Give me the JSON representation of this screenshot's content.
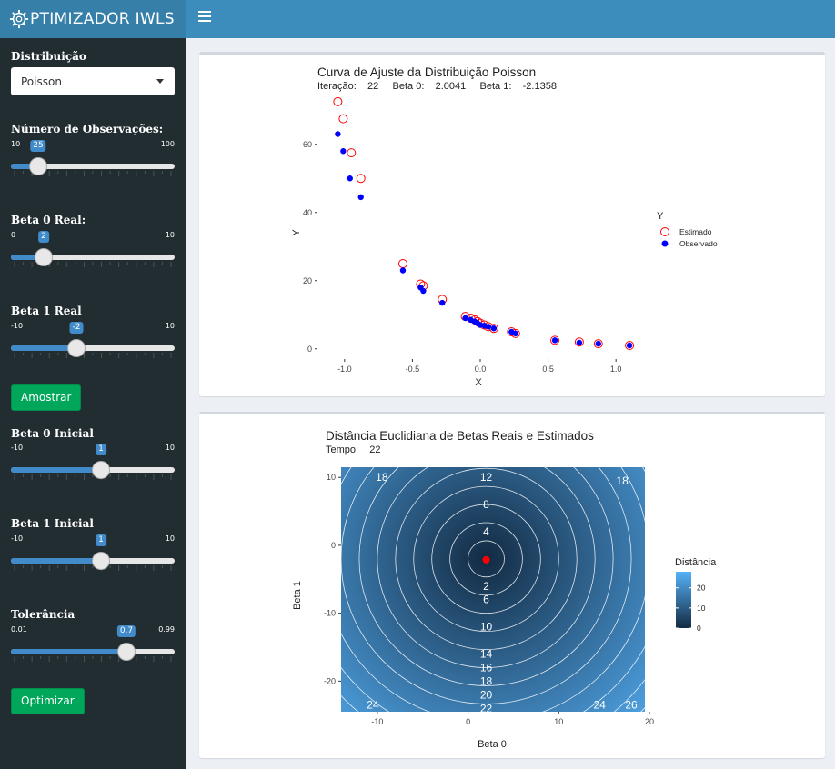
{
  "header": {
    "app_title": "PTIMIZADOR IWLS"
  },
  "sidebar": {
    "distribution": {
      "label": "Distribuição",
      "selected": "Poisson"
    },
    "n_obs": {
      "label": "Número de Observações:",
      "min": "10",
      "max": "100",
      "value": "25",
      "fraction": 0.1667
    },
    "beta0_real": {
      "label": "Beta 0 Real:",
      "min": "0",
      "max": "10",
      "value": "2",
      "fraction": 0.2
    },
    "beta1_real": {
      "label": "Beta 1 Real",
      "min": "-10",
      "max": "10",
      "value": "-2",
      "fraction": 0.4
    },
    "sample_button": "Amostrar",
    "beta0_init": {
      "label": "Beta 0 Inicial",
      "min": "-10",
      "max": "10",
      "value": "1",
      "fraction": 0.55
    },
    "beta1_init": {
      "label": "Beta 1 Inicial",
      "min": "-10",
      "max": "10",
      "value": "1",
      "fraction": 0.55
    },
    "tolerance": {
      "label": "Tolerância",
      "min": "0.01",
      "max": "0.99",
      "value": "0.7",
      "fraction": 0.704
    },
    "optimize_button": "Optimizar"
  },
  "chart_data": [
    {
      "type": "scatter",
      "title": "Curva de Ajuste da Distribuição Poisson",
      "subtitle": "Iteração:    22     Beta 0:    2.0041     Beta 1:    -2.1358",
      "xlabel": "X",
      "ylabel": "Y",
      "xlim": [
        -1.2,
        1.2
      ],
      "ylim": [
        -3,
        73
      ],
      "xticks": [
        "-1.0",
        "-0.5",
        "0.0",
        "0.5",
        "1.0"
      ],
      "yticks": [
        "0",
        "20",
        "40",
        "60"
      ],
      "legend": {
        "title": "Y",
        "position": "right",
        "entries": [
          "Estimado",
          "Observado"
        ]
      },
      "series": [
        {
          "name": "Estimado",
          "color": "#ff0000",
          "marker": "open-circle",
          "points": [
            [
              -1.05,
              72.5
            ],
            [
              -1.01,
              67.5
            ],
            [
              -0.95,
              57.5
            ],
            [
              -0.88,
              50.0
            ],
            [
              -0.57,
              25.0
            ],
            [
              -0.44,
              19.0
            ],
            [
              -0.42,
              18.5
            ],
            [
              -0.28,
              14.5
            ],
            [
              -0.11,
              9.5
            ],
            [
              -0.07,
              9.0
            ],
            [
              -0.04,
              8.5
            ],
            [
              -0.02,
              8.0
            ],
            [
              0.0,
              7.5
            ],
            [
              0.03,
              7.0
            ],
            [
              0.06,
              6.5
            ],
            [
              0.1,
              6.0
            ],
            [
              0.23,
              5.0
            ],
            [
              0.26,
              4.5
            ],
            [
              0.55,
              2.5
            ],
            [
              0.73,
              2.0
            ],
            [
              0.87,
              1.5
            ],
            [
              1.1,
              1.0
            ]
          ]
        },
        {
          "name": "Observado",
          "color": "#0000ff",
          "marker": "filled-circle",
          "points": [
            [
              -1.05,
              63.0
            ],
            [
              -1.01,
              58.0
            ],
            [
              -0.96,
              50.0
            ],
            [
              -0.88,
              44.5
            ],
            [
              -0.57,
              23.0
            ],
            [
              -0.44,
              18.0
            ],
            [
              -0.42,
              17.0
            ],
            [
              -0.28,
              13.5
            ],
            [
              -0.11,
              9.0
            ],
            [
              -0.07,
              8.5
            ],
            [
              -0.04,
              8.0
            ],
            [
              -0.02,
              7.5
            ],
            [
              0.0,
              7.0
            ],
            [
              0.03,
              6.8
            ],
            [
              0.06,
              6.5
            ],
            [
              0.1,
              6.0
            ],
            [
              0.23,
              5.0
            ],
            [
              0.26,
              4.5
            ],
            [
              0.55,
              2.5
            ],
            [
              0.73,
              1.8
            ],
            [
              0.87,
              1.5
            ],
            [
              1.1,
              1.0
            ]
          ]
        }
      ]
    },
    {
      "type": "heatmap",
      "title": "Distância Euclidiana de Betas Reais e Estimados",
      "subtitle": "Tempo:    22",
      "xlabel": "Beta 0",
      "ylabel": "Beta 1",
      "xlim": [
        -14,
        19.5
      ],
      "ylim": [
        -24.5,
        11.5
      ],
      "xticks": [
        "-10",
        "0",
        "10",
        "20"
      ],
      "yticks": [
        "10",
        "0",
        "-10",
        "-20"
      ],
      "center": [
        2,
        -2
      ],
      "point": [
        2.0041,
        -2.1358
      ],
      "contour_levels": [
        2,
        4,
        6,
        8,
        10,
        12,
        14,
        16,
        18,
        20,
        22,
        24,
        26
      ],
      "contour_labels": [
        {
          "text": "12",
          "x": 2,
          "y": 10
        },
        {
          "text": "8",
          "x": 2,
          "y": 6
        },
        {
          "text": "4",
          "x": 2,
          "y": 2
        },
        {
          "text": "2",
          "x": 2,
          "y": -6
        },
        {
          "text": "6",
          "x": 2,
          "y": -8
        },
        {
          "text": "10",
          "x": 2,
          "y": -12
        },
        {
          "text": "14",
          "x": 2,
          "y": -16
        },
        {
          "text": "16",
          "x": 2,
          "y": -18
        },
        {
          "text": "18",
          "x": 2,
          "y": -20
        },
        {
          "text": "20",
          "x": 2,
          "y": -22
        },
        {
          "text": "22",
          "x": 2,
          "y": -24
        },
        {
          "text": "18",
          "x": -9.5,
          "y": 10
        },
        {
          "text": "18",
          "x": 17,
          "y": 9.5
        },
        {
          "text": "24",
          "x": -10.5,
          "y": -23.5
        },
        {
          "text": "24",
          "x": 14.5,
          "y": -23.5
        },
        {
          "text": "26",
          "x": 18,
          "y": -23.5
        }
      ],
      "legend": {
        "title": "Distância",
        "position": "right",
        "ticks": [
          "20",
          "10",
          "0"
        ],
        "range": [
          0,
          28
        ],
        "color_low": "#132b43",
        "color_high": "#56b1f7"
      }
    }
  ]
}
